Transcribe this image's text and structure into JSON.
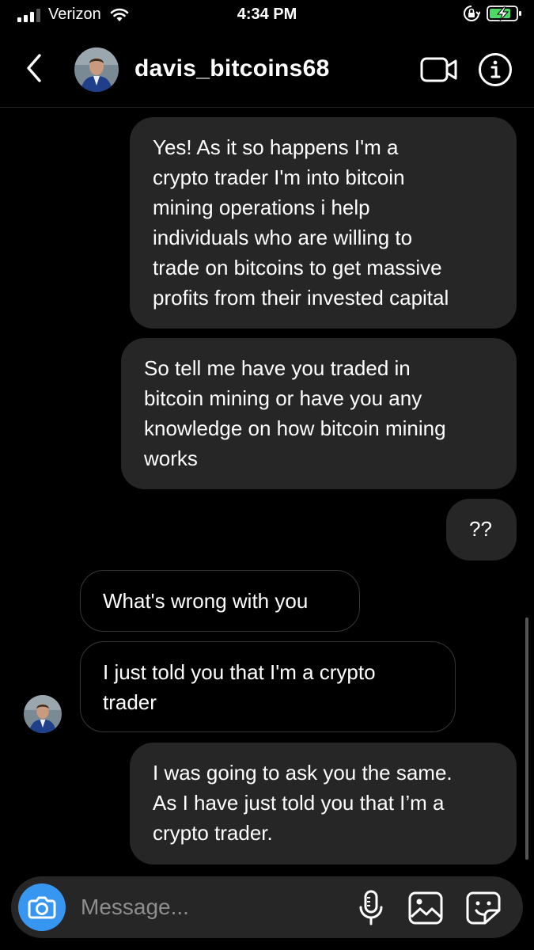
{
  "status_bar": {
    "carrier": "Verizon",
    "time": "4:34 PM",
    "icons": [
      "signal-icon",
      "wifi-icon",
      "rotation-lock-icon",
      "battery-charging-icon"
    ]
  },
  "header": {
    "username": "davis_bitcoins68",
    "icons": [
      "back-chevron-icon",
      "avatar",
      "video-call-icon",
      "info-icon"
    ]
  },
  "messages": [
    {
      "direction": "outgoing",
      "text": "Yes! As it so happens I'm a\ncrypto trader I'm into bitcoin\nmining operations i help\nindividuals who are willing to\ntrade on bitcoins to get massive\nprofits from their invested capital"
    },
    {
      "direction": "outgoing",
      "text": "So tell me have you traded in\nbitcoin mining or have you any\nknowledge on how bitcoin mining\nworks"
    },
    {
      "direction": "outgoing",
      "text": "??"
    },
    {
      "direction": "incoming",
      "text": "What's wrong with you"
    },
    {
      "direction": "incoming",
      "text": "I just  told you that I'm  a crypto\ntrader"
    },
    {
      "direction": "outgoing",
      "text": "I was going to ask you the same.\nAs I have just told you that I’m a\ncrypto trader."
    }
  ],
  "composer": {
    "placeholder": "Message...",
    "value": "",
    "icons": [
      "camera-icon",
      "microphone-icon",
      "gallery-icon",
      "sticker-icon"
    ]
  },
  "colors": {
    "background": "#000000",
    "outgoing_bubble": "#262626",
    "incoming_border": "#363636",
    "camera_button": "#3797f0",
    "battery_charge": "#4cd964"
  }
}
